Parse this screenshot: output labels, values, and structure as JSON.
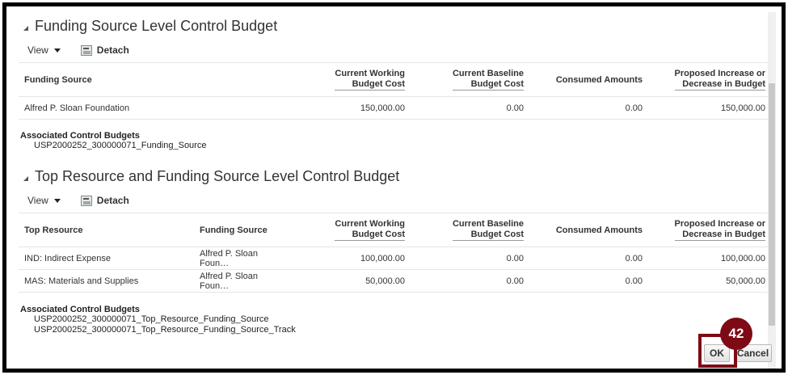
{
  "section1": {
    "title": "Funding Source Level Control Budget",
    "view_label": "View",
    "detach_label": "Detach",
    "columns": [
      "Funding Source",
      "Current Working Budget Cost",
      "Current Baseline Budget Cost",
      "Consumed Amounts",
      "Proposed Increase or Decrease in Budget"
    ],
    "col_lines": {
      "c1a": "Current Working",
      "c1b": "Budget Cost",
      "c2a": "Current Baseline",
      "c2b": "Budget Cost",
      "c4a": "Proposed Increase or",
      "c4b": "Decrease in Budget"
    },
    "rows": [
      {
        "funding_source": "Alfred P. Sloan Foundation",
        "working": "150,000.00",
        "baseline": "0.00",
        "consumed": "0.00",
        "proposed": "150,000.00"
      }
    ],
    "assoc_heading": "Associated Control Budgets",
    "assoc_items": [
      "USP2000252_300000071_Funding_Source"
    ]
  },
  "section2": {
    "title": "Top Resource and Funding Source Level Control Budget",
    "view_label": "View",
    "detach_label": "Detach",
    "columns": [
      "Top Resource",
      "Funding Source",
      "Current Working Budget Cost",
      "Current Baseline Budget Cost",
      "Consumed Amounts",
      "Proposed Increase or Decrease in Budget"
    ],
    "col_lines": {
      "c1a": "Current Working",
      "c1b": "Budget Cost",
      "c2a": "Current Baseline",
      "c2b": "Budget Cost",
      "c4a": "Proposed Increase or",
      "c4b": "Decrease in Budget"
    },
    "rows": [
      {
        "top_resource": "IND: Indirect Expense",
        "funding_source": "Alfred P. Sloan Foun…",
        "working": "100,000.00",
        "baseline": "0.00",
        "consumed": "0.00",
        "proposed": "100,000.00"
      },
      {
        "top_resource": "MAS: Materials and Supplies",
        "funding_source": "Alfred P. Sloan Foun…",
        "working": "50,000.00",
        "baseline": "0.00",
        "consumed": "0.00",
        "proposed": "50,000.00"
      }
    ],
    "assoc_heading": "Associated Control Budgets",
    "assoc_items": [
      "USP2000252_300000071_Top_Resource_Funding_Source",
      "USP2000252_300000071_Top_Resource_Funding_Source_Track"
    ]
  },
  "footer": {
    "ok_label": "OK",
    "cancel_label": "Cancel",
    "step_number": "42"
  },
  "colors": {
    "highlight": "#7d0a14",
    "frame": "#000000"
  }
}
